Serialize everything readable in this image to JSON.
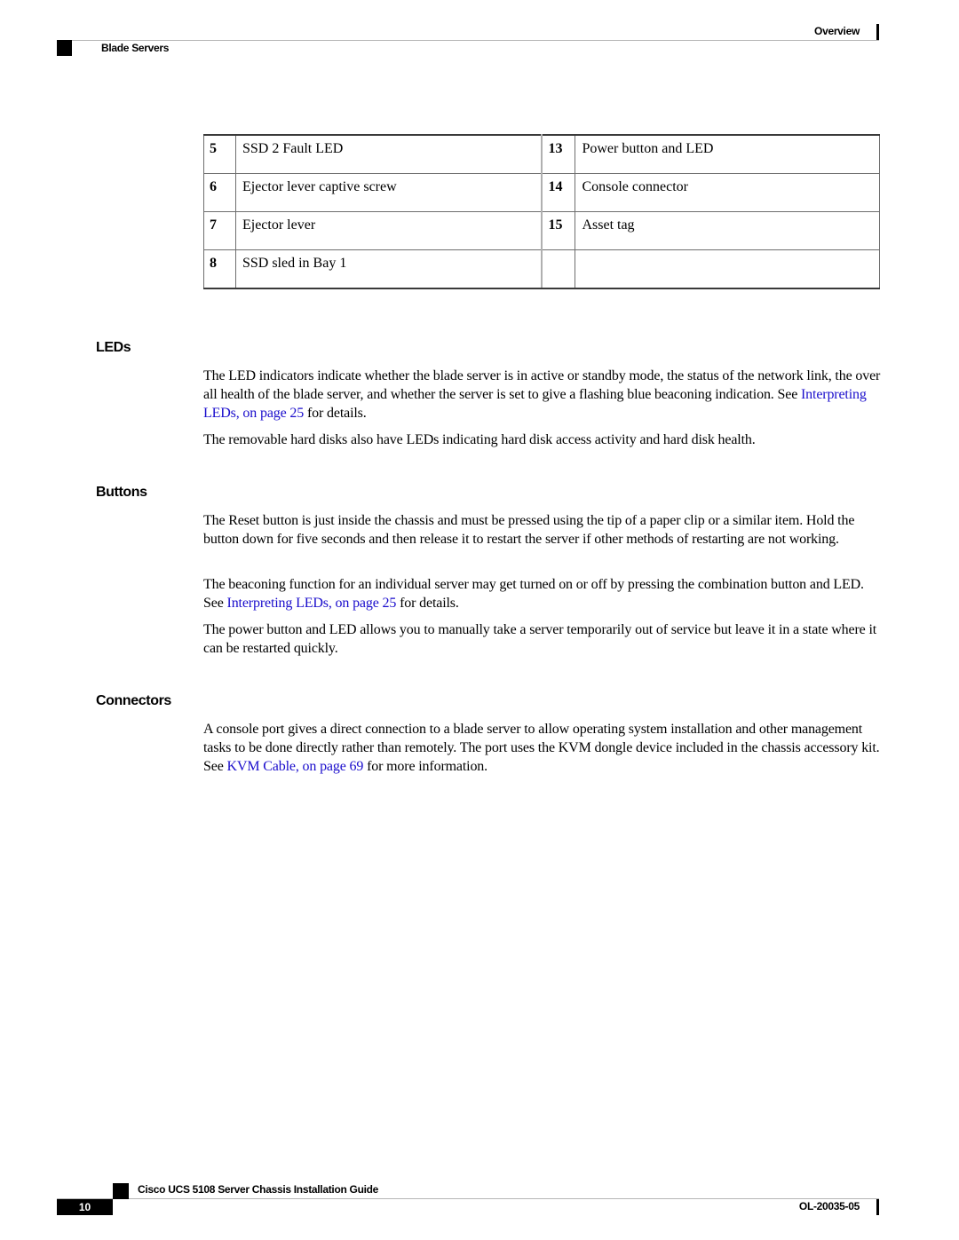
{
  "header": {
    "chapter": "Overview",
    "section": "Blade Servers"
  },
  "callout_table": {
    "rows": [
      {
        "left_num": "5",
        "left_desc": "SSD 2 Fault LED",
        "right_num": "13",
        "right_desc": "Power button and LED"
      },
      {
        "left_num": "6",
        "left_desc": "Ejector lever captive screw",
        "right_num": "14",
        "right_desc": "Console connector"
      },
      {
        "left_num": "7",
        "left_desc": "Ejector lever",
        "right_num": "15",
        "right_desc": "Asset tag"
      },
      {
        "left_num": "8",
        "left_desc": "SSD sled in Bay 1",
        "right_num": "",
        "right_desc": ""
      }
    ]
  },
  "sections": {
    "leds": {
      "heading": "LEDs",
      "p1_before": "The LED indicators indicate whether the blade server is in active or standby mode, the status of the network link, the over all health of the blade server, and whether the server is set to give a flashing blue beaconing indication. See ",
      "p1_link": "Interpreting LEDs,  on page 25",
      "p1_after": " for details.",
      "p2": "The removable hard disks also have LEDs indicating hard disk access activity and hard disk health."
    },
    "buttons": {
      "heading": "Buttons",
      "p1": "The Reset button is just inside the chassis and must be pressed using the tip of a paper clip or a similar item. Hold the button down for five seconds and then release it to restart the server if other methods of restarting are not working.",
      "p2_before": "The beaconing function for an individual server may get turned on or off by pressing the combination button and LED. See ",
      "p2_link": "Interpreting LEDs,  on page 25",
      "p2_after": " for details.",
      "p3": "The power button and LED allows you to manually take a server temporarily out of service but leave it in a state where it can be restarted quickly."
    },
    "connectors": {
      "heading": "Connectors",
      "p1_before": "A console port gives a direct connection to a blade server to allow operating system installation and other management tasks to be done directly rather than remotely. The port uses the KVM dongle device included in the chassis accessory kit. See ",
      "p1_link": "KVM Cable,  on page 69",
      "p1_after": " for more information."
    }
  },
  "footer": {
    "page_number": "10",
    "guide_title": "Cisco UCS 5108 Server Chassis Installation Guide",
    "doc_number": "OL-20035-05"
  },
  "colors": {
    "link": "#1a0dcc",
    "text": "#000000"
  }
}
